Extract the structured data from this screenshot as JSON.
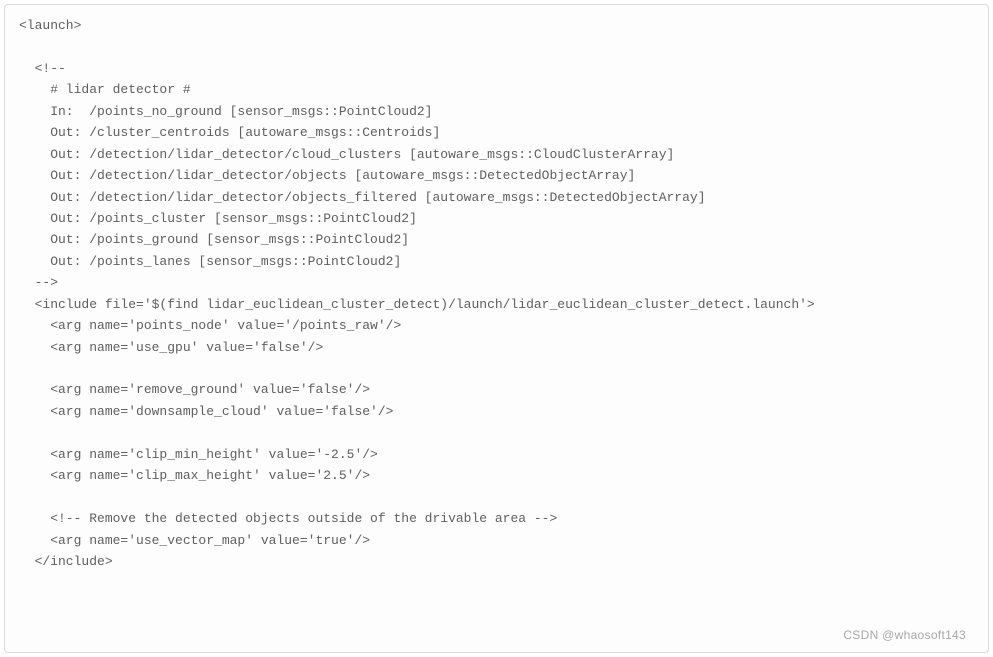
{
  "code": {
    "lines": [
      "<launch>",
      "",
      "  <!--",
      "    # lidar detector #",
      "    In:  /points_no_ground [sensor_msgs::PointCloud2]",
      "    Out: /cluster_centroids [autoware_msgs::Centroids]",
      "    Out: /detection/lidar_detector/cloud_clusters [autoware_msgs::CloudClusterArray]",
      "    Out: /detection/lidar_detector/objects [autoware_msgs::DetectedObjectArray]",
      "    Out: /detection/lidar_detector/objects_filtered [autoware_msgs::DetectedObjectArray]",
      "    Out: /points_cluster [sensor_msgs::PointCloud2]",
      "    Out: /points_ground [sensor_msgs::PointCloud2]",
      "    Out: /points_lanes [sensor_msgs::PointCloud2]",
      "  -->",
      "  <include file='$(find lidar_euclidean_cluster_detect)/launch/lidar_euclidean_cluster_detect.launch'>",
      "    <arg name='points_node' value='/points_raw'/>",
      "    <arg name='use_gpu' value='false'/>",
      "",
      "    <arg name='remove_ground' value='false'/>",
      "    <arg name='downsample_cloud' value='false'/>",
      "",
      "    <arg name='clip_min_height' value='-2.5'/>",
      "    <arg name='clip_max_height' value='2.5'/>",
      "",
      "    <!-- Remove the detected objects outside of the drivable area -->",
      "    <arg name='use_vector_map' value='true'/>",
      "  </include>"
    ]
  },
  "watermark": "CSDN @whaosoft143"
}
